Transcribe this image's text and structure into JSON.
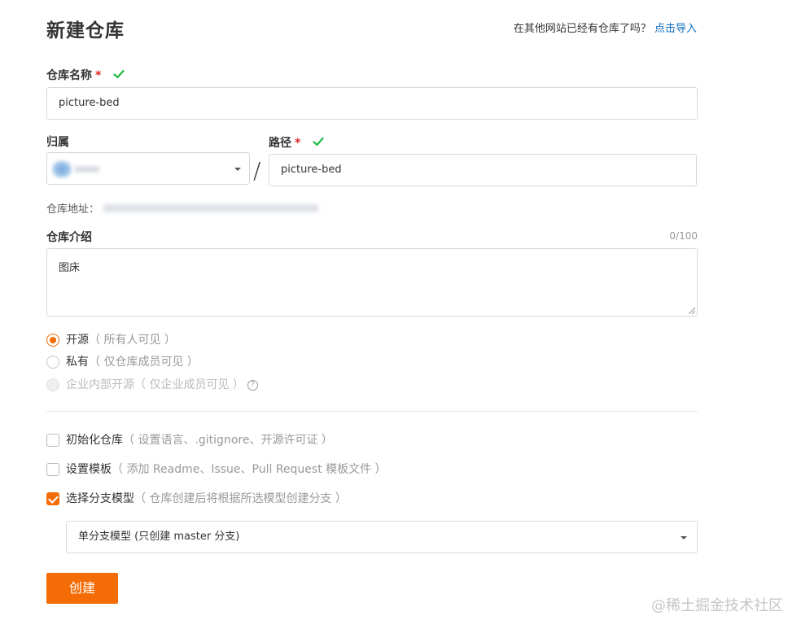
{
  "page": {
    "title": "新建仓库",
    "import_prompt": "在其他网站已经有仓库了吗？",
    "import_link": "点击导入"
  },
  "repo_name": {
    "label": "仓库名称",
    "required_mark": "*",
    "value": "picture-bed"
  },
  "owner": {
    "label": "归属",
    "value": ""
  },
  "path_separator": "/",
  "path": {
    "label": "路径",
    "required_mark": "*",
    "value": "picture-bed"
  },
  "address": {
    "label": "仓库地址："
  },
  "description": {
    "label": "仓库介绍",
    "counter": "0/100",
    "value": "图床"
  },
  "visibility": {
    "options": [
      {
        "label": "开源",
        "hint": "（ 所有人可见 ）",
        "selected": true,
        "disabled": false
      },
      {
        "label": "私有",
        "hint": "（ 仅仓库成员可见 ）",
        "selected": false,
        "disabled": false
      },
      {
        "label": "企业内部开源",
        "hint": "（ 仅企业成员可见 ）",
        "selected": false,
        "disabled": true
      }
    ],
    "help_icon": "question-circle-icon",
    "help_glyph": "?"
  },
  "init_options": [
    {
      "label": "初始化仓库",
      "hint": "（ 设置语言、.gitignore、开源许可证 ）",
      "checked": false
    },
    {
      "label": "设置模板",
      "hint": "（ 添加 Readme、Issue、Pull Request 模板文件 ）",
      "checked": false
    },
    {
      "label": "选择分支模型",
      "hint": "（ 仓库创建后将根据所选模型创建分支 ）",
      "checked": true
    }
  ],
  "branch_model": {
    "selected": "单分支模型 (只创建 master 分支)"
  },
  "submit_label": "创建",
  "watermark": "@稀土掘金技术社区",
  "colors": {
    "accent": "#f36c05",
    "link": "#0b6cc1",
    "success": "#21ba45",
    "required": "#db2828"
  }
}
